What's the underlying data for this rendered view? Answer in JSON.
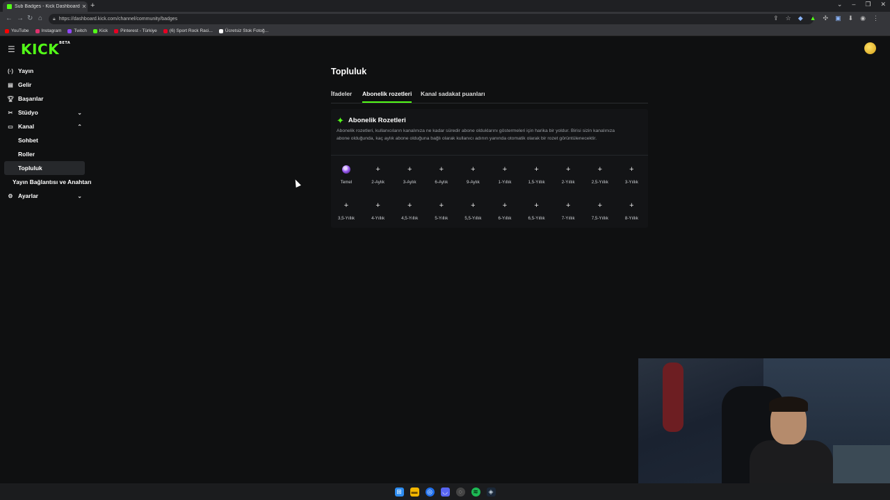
{
  "browser": {
    "tab_title": "Sub Badges - Kick Dashboard",
    "url": "https://dashboard.kick.com/channel/community/badges",
    "bookmarks": [
      {
        "label": "YouTube",
        "color": "#ff0000"
      },
      {
        "label": "Instagram",
        "color": "#e1306c"
      },
      {
        "label": "Twitch",
        "color": "#9146ff"
      },
      {
        "label": "Kick",
        "color": "#53fc18"
      },
      {
        "label": "Pinterest - Türkiye",
        "color": "#e60023"
      },
      {
        "label": "(6) Sport Rock Raci...",
        "color": "#e60023"
      },
      {
        "label": "Ücretsiz Stok Fotoğ...",
        "color": "#ffffff"
      }
    ]
  },
  "header": {
    "logo": "KICK",
    "logo_sup": "BETA"
  },
  "sidebar": {
    "items": [
      {
        "label": "Yayın",
        "icon": "broadcast-icon"
      },
      {
        "label": "Gelir",
        "icon": "revenue-icon"
      },
      {
        "label": "Başarılar",
        "icon": "trophy-icon"
      },
      {
        "label": "Stüdyo",
        "icon": "studio-icon"
      },
      {
        "label": "Kanal",
        "icon": "channel-icon"
      },
      {
        "label": "Sohbet"
      },
      {
        "label": "Roller"
      },
      {
        "label": "Topluluk"
      },
      {
        "label": "Yayın Bağlantısı ve Anahtarı"
      },
      {
        "label": "Ayarlar",
        "icon": "gear-icon"
      }
    ]
  },
  "main": {
    "title": "Topluluk",
    "tabs": [
      {
        "label": "İfadeler"
      },
      {
        "label": "Abonelik rozetleri"
      },
      {
        "label": "Kanal sadakat puanları"
      }
    ],
    "card": {
      "title": "Abonelik Rozetleri",
      "description": "Abonelik rozetleri, kullanıcıların kanalınıza ne kadar süredir abone olduklarını göstermeleri için harika bir yoldur. Birisi sizin kanalınıza abone olduğunda, kaç aylık abone olduğuna bağlı olarak kullanıcı adının yanında otomatik olarak bir rozet görüntülenecektir.",
      "badges_row1": [
        "Temel",
        "2-Aylık",
        "3-Aylık",
        "6-Aylık",
        "9-Aylık",
        "1-Yıllık",
        "1,5-Yıllık",
        "2-Yıllık",
        "2,5-Yıllık",
        "3-Yıllık"
      ],
      "badges_row2": [
        "3,5-Yıllık",
        "4-Yıllık",
        "4,5-Yıllık",
        "5-Yıllık",
        "5,5-Yıllık",
        "6-Yıllık",
        "6,5-Yıllık",
        "7-Yıllık",
        "7,5-Yıllık",
        "8-Yıllık"
      ],
      "add_symbol": "+"
    }
  },
  "colors": {
    "accent": "#53fc18",
    "background": "#0f1011"
  }
}
